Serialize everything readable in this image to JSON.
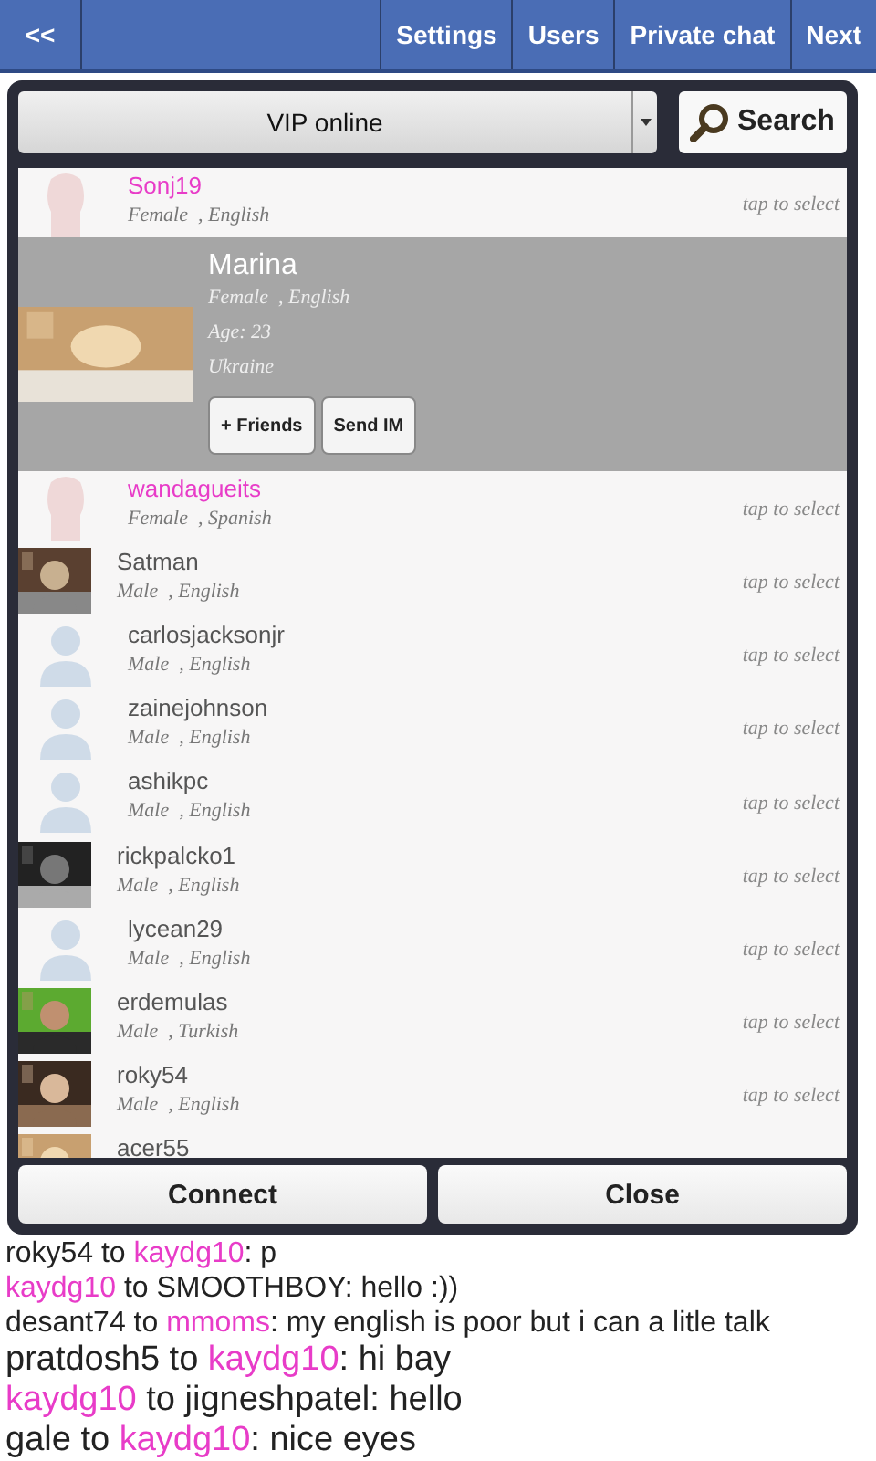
{
  "nav": {
    "back": "<<",
    "items": [
      "Settings",
      "Users",
      "Private chat",
      "Next"
    ]
  },
  "dialog": {
    "filter": {
      "value": "VIP online"
    },
    "search": "Search",
    "users": [
      {
        "name": "Sonj19",
        "color": "#e83cc8",
        "meta": "Female  , English",
        "hint": "tap to select",
        "kind": "female",
        "expanded": false
      },
      {
        "name": "Marina",
        "color": "#ffffff",
        "meta": "Female  , English",
        "age": "Age: 23",
        "country": "Ukraine",
        "expanded": true,
        "actions": [
          "+ Friends",
          "Send IM"
        ]
      },
      {
        "name": "wandagueits",
        "color": "#e83cc8",
        "meta": "Female  , Spanish",
        "hint": "tap to select",
        "kind": "female",
        "expanded": false
      },
      {
        "name": "Satman",
        "color": "#555555",
        "meta": "Male  , English",
        "hint": "tap to select",
        "expanded": false
      },
      {
        "name": "carlosjacksonjr",
        "color": "#555555",
        "meta": "Male  , English",
        "hint": "tap to select",
        "kind": "male",
        "expanded": false
      },
      {
        "name": "zainejohnson",
        "color": "#555555",
        "meta": "Male  , English",
        "hint": "tap to select",
        "kind": "male",
        "expanded": false
      },
      {
        "name": "ashikpc",
        "color": "#555555",
        "meta": "Male  , English",
        "hint": "tap to select",
        "kind": "male",
        "expanded": false
      },
      {
        "name": "rickpalcko1",
        "color": "#555555",
        "meta": "Male  , English",
        "hint": "tap to select",
        "expanded": false
      },
      {
        "name": "lycean29",
        "color": "#555555",
        "meta": "Male  , English",
        "hint": "tap to select",
        "kind": "male",
        "expanded": false
      },
      {
        "name": "erdemulas",
        "color": "#555555",
        "meta": "Male  , Turkish",
        "hint": "tap to select",
        "expanded": false
      },
      {
        "name": "roky54",
        "color": "#555555",
        "meta": "Male  , English",
        "hint": "tap to select",
        "expanded": false
      },
      {
        "name": "acer55",
        "color": "#555555",
        "expanded": false
      }
    ],
    "buttons": [
      "Connect",
      "Close"
    ]
  },
  "chat": [
    {
      "kind": "small",
      "parts": [
        {
          "text": "roky54",
          "highlight": false
        },
        {
          "text": " to ",
          "highlight": false
        },
        {
          "text": "kaydg10",
          "highlight": true
        },
        {
          "text": ": p",
          "highlight": false
        }
      ]
    },
    {
      "kind": "small",
      "parts": [
        {
          "text": "kaydg10",
          "highlight": true
        },
        {
          "text": " to SMOOTHBOY: hello :))",
          "highlight": false
        }
      ]
    },
    {
      "kind": "small",
      "parts": [
        {
          "text": "desant74 to ",
          "highlight": false
        },
        {
          "text": "mmoms",
          "highlight": true
        },
        {
          "text": ": my english is poor  but i can a litle talk",
          "highlight": false
        }
      ]
    },
    {
      "kind": "large",
      "parts": [
        {
          "text": "pratdosh5 to ",
          "highlight": false
        },
        {
          "text": "kaydg10",
          "highlight": true
        },
        {
          "text": ": hi bay",
          "highlight": false
        }
      ]
    },
    {
      "kind": "large",
      "parts": [
        {
          "text": "kaydg10",
          "highlight": true
        },
        {
          "text": " to jigneshpatel: hello",
          "highlight": false
        }
      ]
    },
    {
      "kind": "large",
      "parts": [
        {
          "text": "gale to ",
          "highlight": false
        },
        {
          "text": "kaydg10",
          "highlight": true
        },
        {
          "text": ": nice eyes",
          "highlight": false
        }
      ]
    }
  ]
}
